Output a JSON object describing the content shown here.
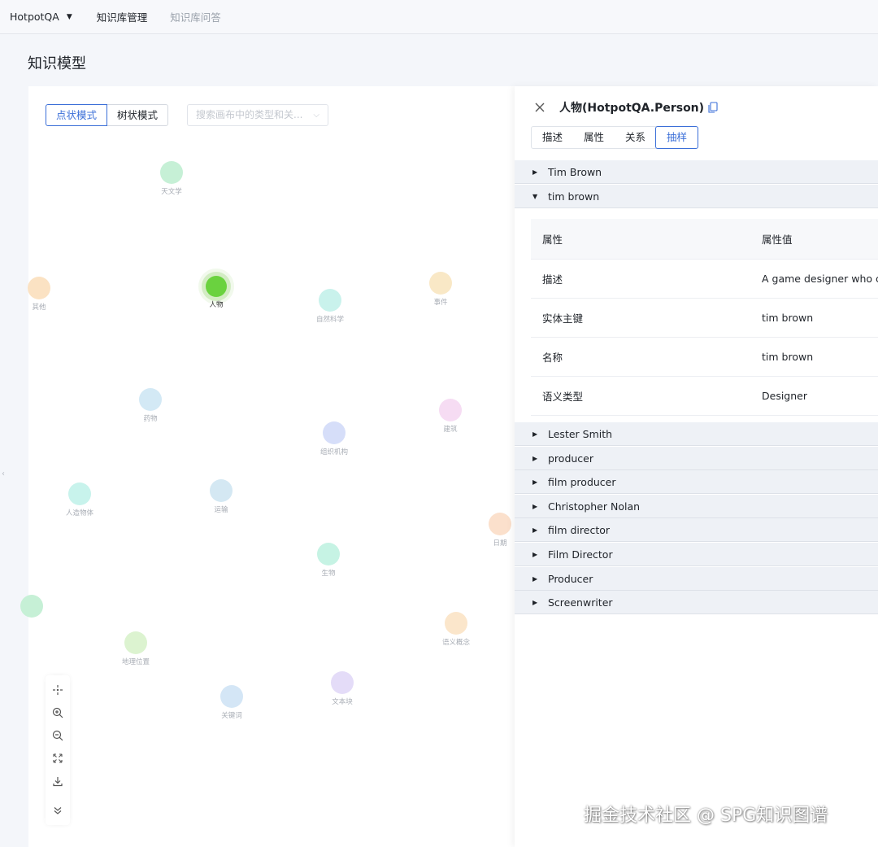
{
  "topbar": {
    "app_name": "HotpotQA",
    "nav": [
      "知识库管理",
      "知识库问答"
    ]
  },
  "page_title": "知识模型",
  "canvas": {
    "modes": [
      "点状模式",
      "树状模式"
    ],
    "search_placeholder": "搜索画布中的类型和关...",
    "nodes": [
      {
        "label": "天文学",
        "color": "#c6f0d6"
      },
      {
        "label": "其他",
        "color": "#fbe2c3"
      },
      {
        "label": "人物",
        "color": "#6ad23f"
      },
      {
        "label": "自然科学",
        "color": "#c9f2ec"
      },
      {
        "label": "事件",
        "color": "#f9e8c6"
      },
      {
        "label": "药物",
        "color": "#d3e9f5"
      },
      {
        "label": "建筑",
        "color": "#f6dcf3"
      },
      {
        "label": "组织机构",
        "color": "#d6def9"
      },
      {
        "label": "人造物体",
        "color": "#c8f3ec"
      },
      {
        "label": "运输",
        "color": "#d4e8f3"
      },
      {
        "label": "日期",
        "color": "#fbe0cc"
      },
      {
        "label": "生物",
        "color": "#c6f3e4"
      },
      {
        "label": "语义概念",
        "color": "#fbe6cb"
      },
      {
        "label": "地理位置",
        "color": "#dcf3d0"
      },
      {
        "label": "文本块",
        "color": "#e4dcf8"
      },
      {
        "label": "关键词",
        "color": "#d4e6f6"
      },
      {
        "label": "",
        "color": "#c6f0d6"
      }
    ]
  },
  "detail": {
    "title": "人物(HotpotQA.Person)",
    "tabs": [
      "描述",
      "属性",
      "关系",
      "抽样"
    ],
    "rows_top": [
      "Tim Brown",
      "tim brown"
    ],
    "table": {
      "headers": [
        "属性",
        "属性值"
      ],
      "rows": [
        [
          "描述",
          "A game designer who c"
        ],
        [
          "实体主键",
          "tim brown"
        ],
        [
          "名称",
          "tim brown"
        ],
        [
          "语义类型",
          "Designer"
        ]
      ]
    },
    "rows_bottom": [
      "Lester Smith",
      "producer",
      "film producer",
      "Christopher Nolan",
      "film director",
      "Film Director",
      "Producer",
      "Screenwriter"
    ]
  },
  "watermark": "掘金技术社区 @ SPG知识图谱"
}
